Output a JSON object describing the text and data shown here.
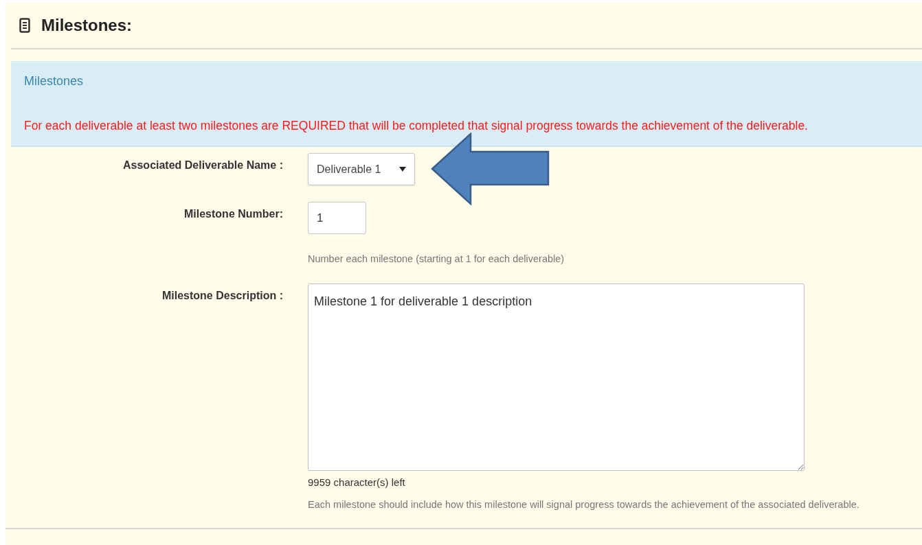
{
  "section": {
    "title": "Milestones:"
  },
  "notice": {
    "heading": "Milestones",
    "warning": "For each deliverable at least two milestones are REQUIRED that will be completed that signal progress towards the achievement of the deliverable."
  },
  "fields": [
    {
      "kind": "select",
      "label": "Associated Deliverable Name :",
      "value": "Deliverable 1"
    },
    {
      "kind": "text",
      "label": "Milestone Number:",
      "value": "1",
      "hint": "Number each milestone (starting at 1 for each deliverable)"
    },
    {
      "kind": "textarea",
      "label": "Milestone Description :",
      "value": "Milestone 1 for deliverable 1 description",
      "counter": "9959 character(s) left",
      "hint": "Each milestone should include how this milestone will signal progress towards the achievement of the associated deliverable."
    }
  ]
}
